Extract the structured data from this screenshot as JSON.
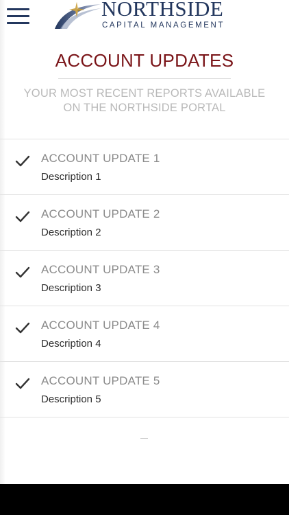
{
  "header": {
    "menu_icon": "hamburger-menu-icon",
    "logo": {
      "name": "NORTHSIDE",
      "tagline": "CAPITAL MANAGEMENT"
    }
  },
  "main": {
    "title": "ACCOUNT UPDATES",
    "subtitle": "YOUR MOST RECENT REPORTS AVAILABLE ON THE NORTHSIDE PORTAL",
    "items": [
      {
        "title": "ACCOUNT UPDATE 1",
        "description": "Description 1",
        "icon": "checkmark-icon"
      },
      {
        "title": "ACCOUNT UPDATE 2",
        "description": "Description 2",
        "icon": "checkmark-icon"
      },
      {
        "title": "ACCOUNT UPDATE 3",
        "description": "Description 3",
        "icon": "checkmark-icon"
      },
      {
        "title": "ACCOUNT UPDATE 4",
        "description": "Description 4",
        "icon": "checkmark-icon"
      },
      {
        "title": "ACCOUNT UPDATE 5",
        "description": "Description 5",
        "icon": "checkmark-icon"
      }
    ]
  },
  "colors": {
    "brand_navy": "#23375e",
    "title_red": "#7a1418",
    "subtitle_gray": "#b9b9b9",
    "item_title_gray": "#8a8a8a",
    "divider": "#e2e2e2"
  }
}
